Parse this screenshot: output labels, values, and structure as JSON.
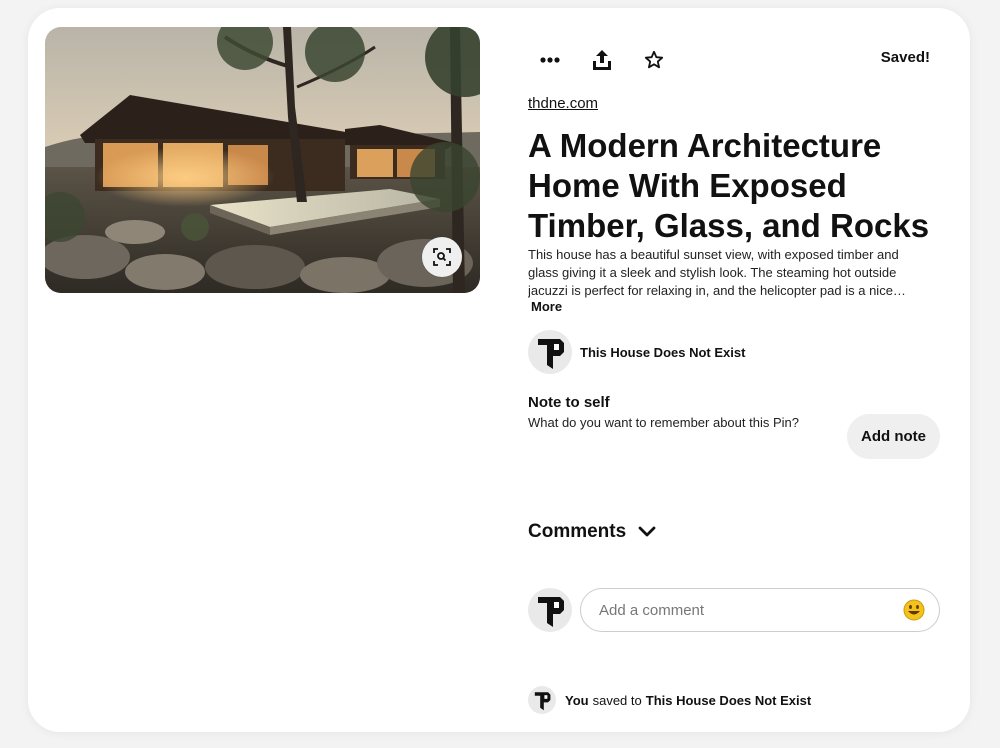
{
  "pin": {
    "source": "thdne.com",
    "title": "A Modern Architecture Home With Exposed Timber, Glass, and Rocks",
    "description": "This house has a beautiful sunset view, with exposed timber and glass giving it a sleek and stylish look. The steaming hot outside jacuzzi is perfect for relaxing in, and the helicopter pad is a nice…",
    "more_label": "More"
  },
  "toolbar": {
    "saved_label": "Saved!",
    "icons": [
      "more-icon",
      "share-icon",
      "star-icon"
    ]
  },
  "creator": {
    "name": "This House Does Not Exist"
  },
  "note": {
    "title": "Note to self",
    "prompt": "What do you want to remember about this Pin?",
    "button_label": "Add note"
  },
  "comments": {
    "label": "Comments",
    "placeholder": "Add a comment"
  },
  "saved_to": {
    "user": "You",
    "middle": "saved to",
    "board": "This House Does Not Exist"
  },
  "colors": {
    "background": "#f3f3f3",
    "card": "#ffffff",
    "button_gray": "#efefef",
    "text": "#111111"
  }
}
